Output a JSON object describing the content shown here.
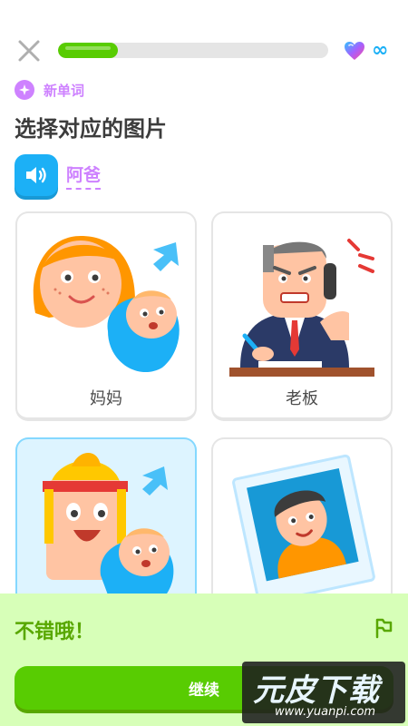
{
  "header": {
    "progress_percent": 22,
    "progress_color": "#58cc02",
    "hearts_icon": "heart-icon",
    "infinity_symbol": "∞"
  },
  "badge": {
    "label": "新单词",
    "color": "#ce82ff"
  },
  "prompt": {
    "title": "选择对应的图片",
    "word": "阿爸"
  },
  "cards": [
    {
      "label": "妈妈",
      "selected": false
    },
    {
      "label": "老板",
      "selected": false
    },
    {
      "label": "",
      "selected": true
    },
    {
      "label": "",
      "selected": false
    }
  ],
  "feedback": {
    "title": "不错哦！",
    "continue_label": "继续",
    "background": "#d7ffb8",
    "title_color": "#58a700"
  },
  "watermark": {
    "main": "元皮下载",
    "url": "www.yuanpi.com"
  }
}
